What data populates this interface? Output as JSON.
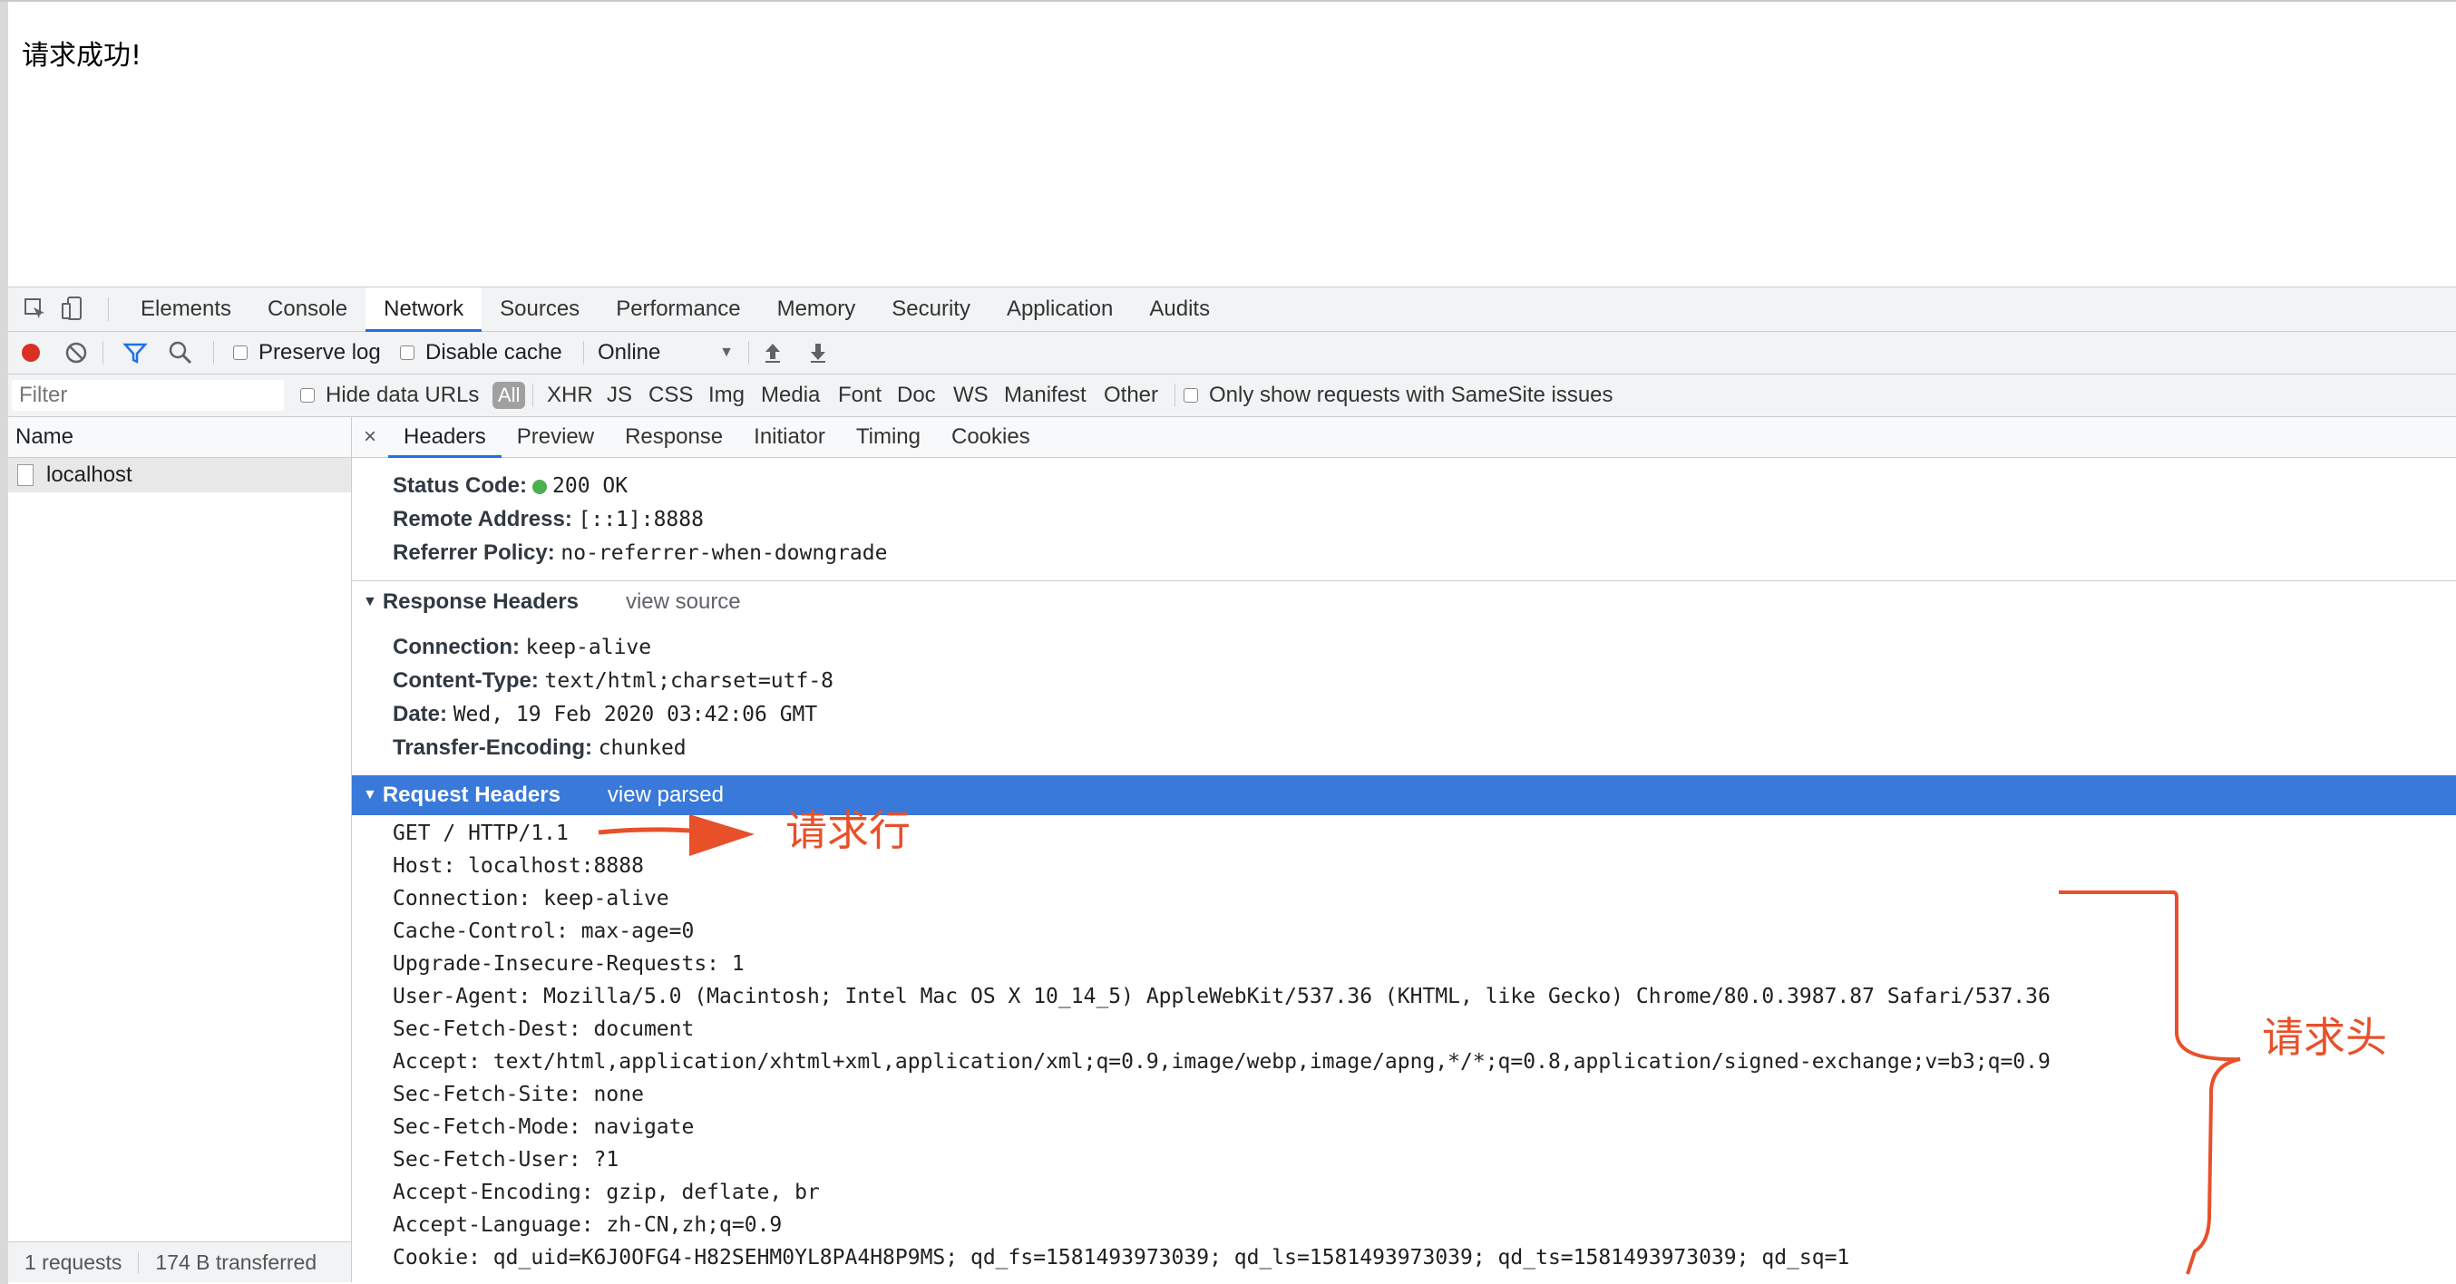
{
  "page": {
    "text": "请求成功!"
  },
  "devtools": {
    "tabs": [
      "Elements",
      "Console",
      "Network",
      "Sources",
      "Performance",
      "Memory",
      "Security",
      "Application",
      "Audits"
    ],
    "active_tab": "Network",
    "toolbar": {
      "preserve_log": "Preserve log",
      "disable_cache": "Disable cache",
      "throttle": "Online"
    },
    "filter": {
      "placeholder": "Filter",
      "hide_data_urls": "Hide data URLs",
      "types": [
        "All",
        "XHR",
        "JS",
        "CSS",
        "Img",
        "Media",
        "Font",
        "Doc",
        "WS",
        "Manifest",
        "Other"
      ],
      "samesite": "Only show requests with SameSite issues"
    },
    "requests": {
      "header": "Name",
      "items": [
        "localhost"
      ]
    },
    "status": {
      "requests": "1 requests",
      "transferred": "174 B transferred"
    },
    "detail_tabs": [
      "Headers",
      "Preview",
      "Response",
      "Initiator",
      "Timing",
      "Cookies"
    ],
    "general": [
      {
        "key": "Status Code:",
        "value": "200 OK"
      },
      {
        "key": "Remote Address:",
        "value": "[::1]:8888"
      },
      {
        "key": "Referrer Policy:",
        "value": "no-referrer-when-downgrade"
      }
    ],
    "response_headers": {
      "title": "Response Headers",
      "link": "view source",
      "items": [
        {
          "key": "Connection:",
          "value": "keep-alive"
        },
        {
          "key": "Content-Type:",
          "value": "text/html;charset=utf-8"
        },
        {
          "key": "Date:",
          "value": "Wed, 19 Feb 2020 03:42:06 GMT"
        },
        {
          "key": "Transfer-Encoding:",
          "value": "chunked"
        }
      ]
    },
    "request_headers": {
      "title": "Request Headers",
      "link": "view parsed",
      "lines": [
        "GET / HTTP/1.1",
        "Host: localhost:8888",
        "Connection: keep-alive",
        "Cache-Control: max-age=0",
        "Upgrade-Insecure-Requests: 1",
        "User-Agent: Mozilla/5.0 (Macintosh; Intel Mac OS X 10_14_5) AppleWebKit/537.36 (KHTML, like Gecko) Chrome/80.0.3987.87 Safari/537.36",
        "Sec-Fetch-Dest: document",
        "Accept: text/html,application/xhtml+xml,application/xml;q=0.9,image/webp,image/apng,*/*;q=0.8,application/signed-exchange;v=b3;q=0.9",
        "Sec-Fetch-Site: none",
        "Sec-Fetch-Mode: navigate",
        "Sec-Fetch-User: ?1",
        "Accept-Encoding: gzip, deflate, br",
        "Accept-Language: zh-CN,zh;q=0.9",
        "Cookie: qd_uid=K6J0OFG4-H82SEHM0YL8PA4H8P9MS; qd_fs=1581493973039; qd_ls=1581493973039; qd_ts=1581493973039; qd_sq=1"
      ]
    }
  },
  "annotations": {
    "request_line": "请求行",
    "request_headers": "请求头"
  }
}
